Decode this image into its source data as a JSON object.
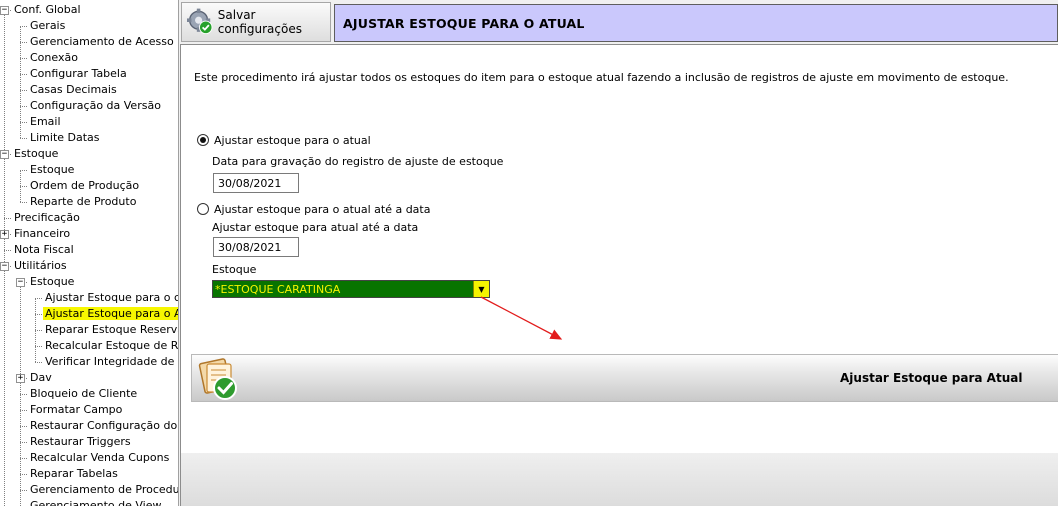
{
  "tree": {
    "items": [
      {
        "label": "Conf. Global",
        "level": 0,
        "expander": "minus"
      },
      {
        "label": "Gerais",
        "level": 1
      },
      {
        "label": "Gerenciamento de Acesso",
        "level": 1
      },
      {
        "label": "Conexão",
        "level": 1
      },
      {
        "label": "Configurar Tabela",
        "level": 1
      },
      {
        "label": "Casas Decimais",
        "level": 1
      },
      {
        "label": "Configuração da Versão",
        "level": 1
      },
      {
        "label": "Email",
        "level": 1
      },
      {
        "label": "Limite Datas",
        "level": 1
      },
      {
        "label": "Estoque",
        "level": 0,
        "expander": "minus"
      },
      {
        "label": "Estoque",
        "level": 1
      },
      {
        "label": "Ordem de Produção",
        "level": 1
      },
      {
        "label": "Reparte de Produto",
        "level": 1
      },
      {
        "label": "Precificação",
        "level": 0
      },
      {
        "label": "Financeiro",
        "level": 0,
        "expander": "plus"
      },
      {
        "label": "Nota Fiscal",
        "level": 0
      },
      {
        "label": "Utilitários",
        "level": 0,
        "expander": "minus"
      },
      {
        "label": "Estoque",
        "level": 1,
        "expander": "minus"
      },
      {
        "label": "Ajustar Estoque para o calculo",
        "level": 2
      },
      {
        "label": "Ajustar Estoque para o Atual",
        "level": 2,
        "selected": true
      },
      {
        "label": "Reparar Estoque Reservado",
        "level": 2
      },
      {
        "label": "Recalcular Estoque de Recebimento",
        "level": 2
      },
      {
        "label": "Verificar Integridade de Linha",
        "level": 2
      },
      {
        "label": "Dav",
        "level": 1,
        "expander": "plus"
      },
      {
        "label": "Bloqueio de Cliente",
        "level": 1
      },
      {
        "label": "Formatar Campo",
        "level": 1
      },
      {
        "label": "Restaurar Configuração do Sistema",
        "level": 1
      },
      {
        "label": "Restaurar Triggers",
        "level": 1
      },
      {
        "label": "Recalcular Venda Cupons",
        "level": 1
      },
      {
        "label": "Reparar Tabelas",
        "level": 1
      },
      {
        "label": "Gerenciamento de Procedure",
        "level": 1
      },
      {
        "label": "Gerenciamento de View",
        "level": 1
      }
    ]
  },
  "toolbar": {
    "save_label": "Salvar configurações",
    "title": "AJUSTAR ESTOQUE PARA O ATUAL"
  },
  "main": {
    "description": "Este procedimento irá ajustar todos os estoques do item para o estoque atual fazendo a inclusão de registros de ajuste em movimento de estoque.",
    "option1": {
      "label": "Ajustar estoque para o atual",
      "selected": true,
      "date_label": "Data para gravação do registro de ajuste de estoque",
      "date_value": "30/08/2021"
    },
    "option2": {
      "label": "Ajustar estoque para o atual até a data",
      "selected": false,
      "date_label": "Ajustar estoque para atual até a data",
      "date_value": "30/08/2021",
      "stock_label": "Estoque",
      "stock_value": "*ESTOQUE CARATINGA"
    },
    "action_label": "Ajustar Estoque para Atual"
  },
  "colors": {
    "header_bg": "#cac8fc",
    "selected_bg": "#f7f700",
    "select_bg": "#087400",
    "select_text": "#f5f500",
    "arrow": "#e21b1b"
  }
}
